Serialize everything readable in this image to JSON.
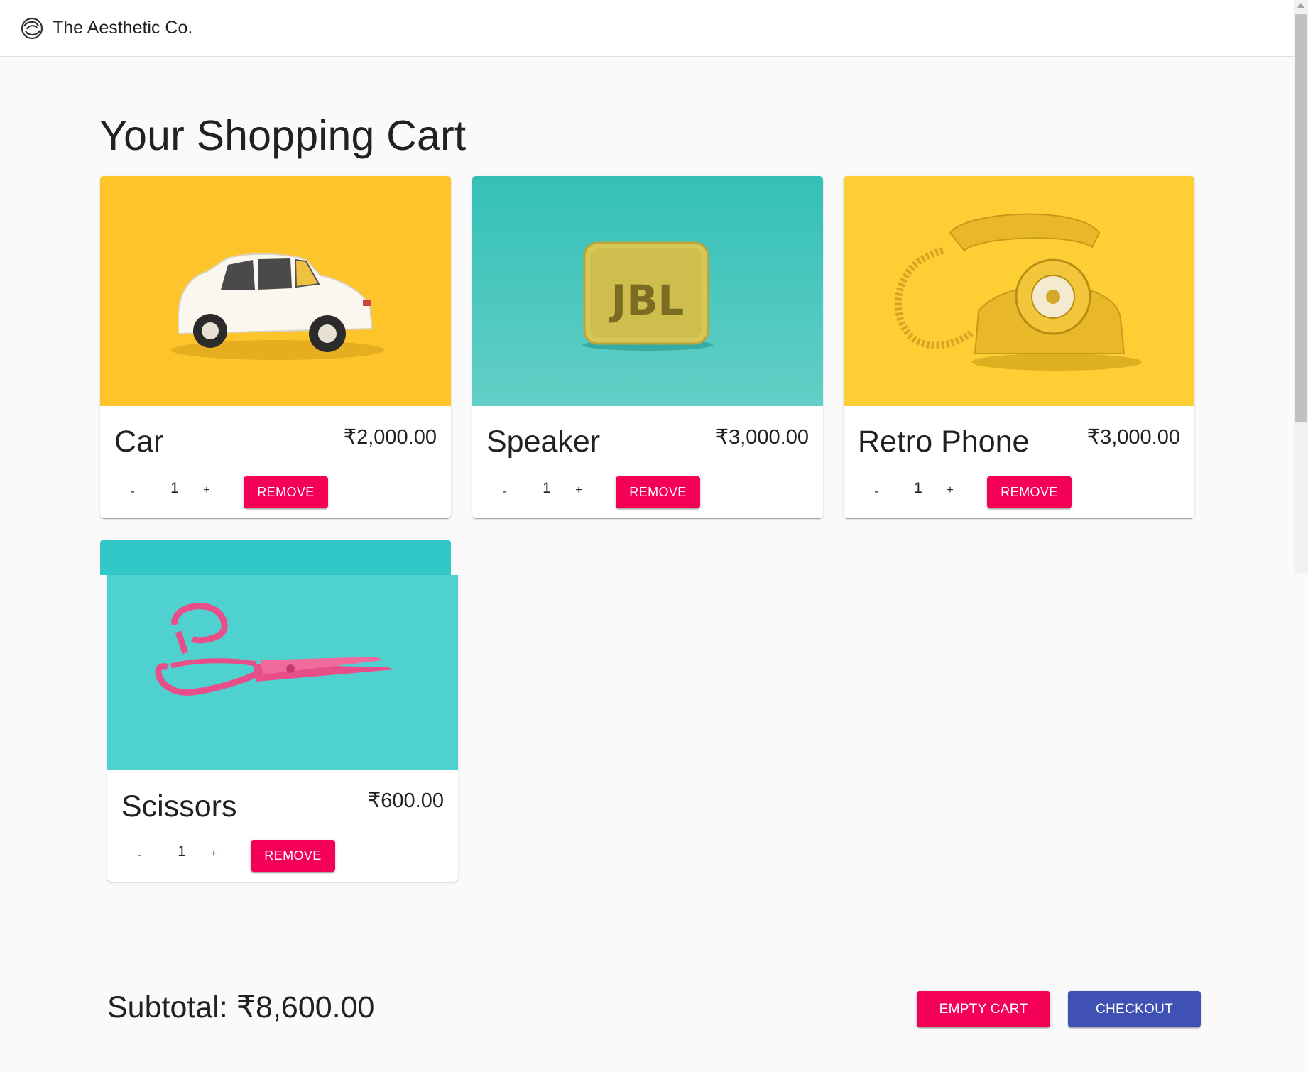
{
  "appbar": {
    "brand": "The Aesthetic Co.",
    "logo_icon": "swirl-logo-icon"
  },
  "page": {
    "title": "Your Shopping Cart"
  },
  "cart": {
    "items": [
      {
        "name": "Car",
        "price": "₹2,000.00",
        "quantity": "1",
        "minus": "-",
        "plus": "+",
        "remove_label": "REMOVE",
        "image": "car-photo",
        "bg": "#fdc52b"
      },
      {
        "name": "Speaker",
        "price": "₹3,000.00",
        "quantity": "1",
        "minus": "-",
        "plus": "+",
        "remove_label": "REMOVE",
        "image": "speaker-photo",
        "bg": "#3cc6be",
        "image_text": "JBL"
      },
      {
        "name": "Retro Phone",
        "price": "₹3,000.00",
        "quantity": "1",
        "minus": "-",
        "plus": "+",
        "remove_label": "REMOVE",
        "image": "phone-photo",
        "bg": "#fdcf35"
      },
      {
        "name": "Scissors",
        "price": "₹600.00",
        "quantity": "1",
        "minus": "-",
        "plus": "+",
        "remove_label": "REMOVE",
        "image": "scissors-photo",
        "bg": "#3ecfcb"
      }
    ]
  },
  "footer": {
    "subtotal": "Subtotal: ₹8,600.00",
    "empty_label": "EMPTY CART",
    "checkout_label": "CHECKOUT"
  },
  "colors": {
    "secondary": "#f50057",
    "primary": "#3f51b5",
    "background": "#fafafa"
  }
}
